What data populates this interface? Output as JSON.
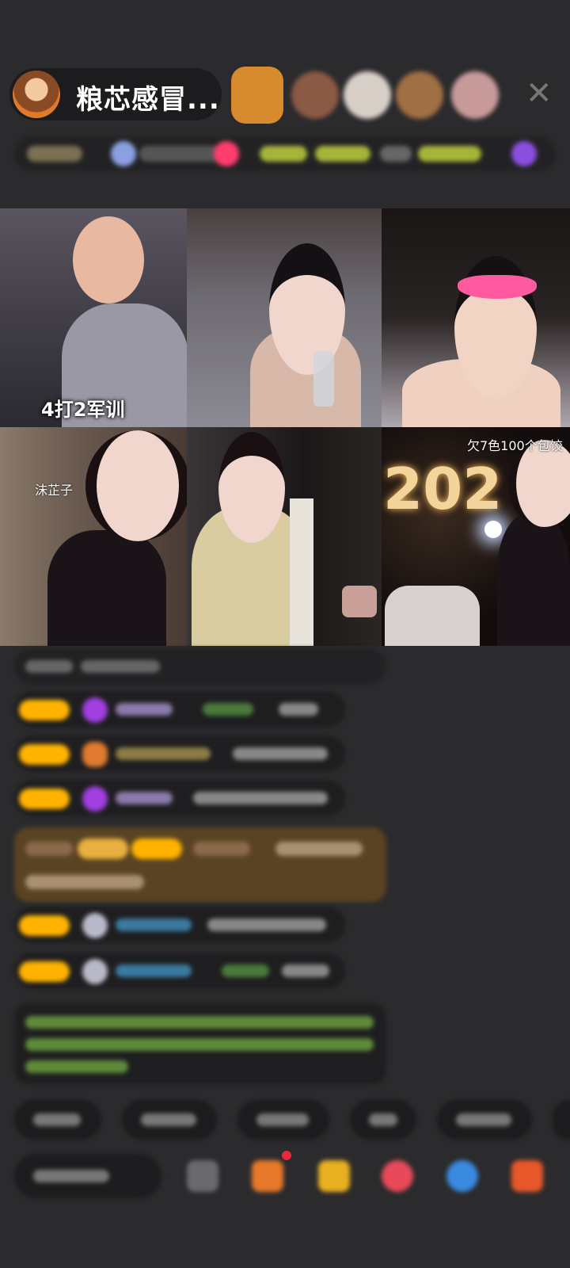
{
  "header": {
    "host_name": "粮芯感冒..."
  },
  "video_grid": {
    "tiles": [
      {
        "caption": "4打2军训"
      },
      {
        "caption": ""
      },
      {
        "caption": ""
      },
      {
        "caption": "",
        "tag": "沫芷子"
      },
      {
        "caption": ""
      },
      {
        "caption": "欠7色100个包饺",
        "year_text": "202"
      }
    ]
  },
  "colors": {
    "background": "#2b2b2d",
    "badge_gold": "#ffb300",
    "gift_highlight": "#5a4322",
    "purple_gem": "#a23fe0",
    "blue_name": "#3aa0c8",
    "green_notice": "#7ec040"
  },
  "icons": {
    "close": "close-icon",
    "gift": "gift-icon",
    "emoji": "emoji-icon"
  }
}
